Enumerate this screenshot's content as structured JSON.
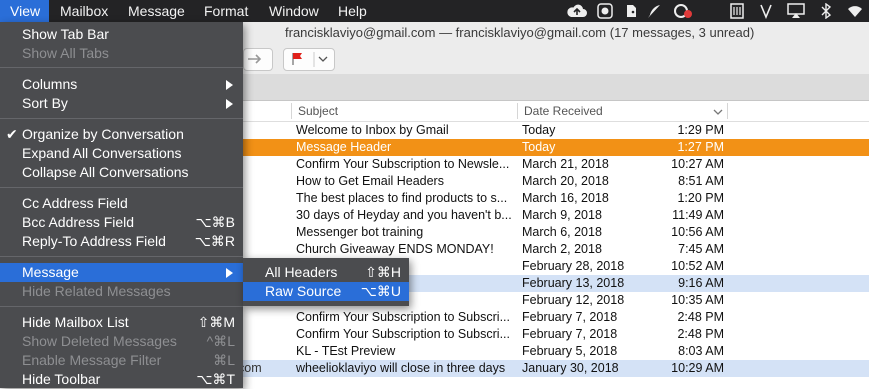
{
  "menubar": {
    "items": [
      "View",
      "Mailbox",
      "Message",
      "Format",
      "Window",
      "Help"
    ],
    "tray_icons": [
      "cloud-upload-icon",
      "record-icon",
      "evernote-icon",
      "feather-icon",
      "sync-icon",
      "notes-icon",
      "vectorworks-icon",
      "airplay-icon",
      "bluetooth-icon",
      "wifi-icon"
    ]
  },
  "window": {
    "title": "franciskla​viyo@gmail.com — franciskla​viyo@gmail.com (17 messages, 3 unread)"
  },
  "list": {
    "columns": {
      "subject": "Subject",
      "date": "Date Received"
    },
    "rows": [
      {
        "from": "",
        "subject": "Welcome to Inbox by Gmail",
        "date": "Today",
        "time": "1:29 PM"
      },
      {
        "from": "",
        "subject": "Message Header",
        "date": "Today",
        "time": "1:27 PM"
      },
      {
        "from": "",
        "subject": "Confirm Your Subscription to Newsle...",
        "date": "March 21, 2018",
        "time": "10:27 AM"
      },
      {
        "from": "",
        "subject": "How to Get Email Headers",
        "date": "March 20, 2018",
        "time": "8:51 AM"
      },
      {
        "from": "",
        "subject": "The best places to find products to s...",
        "date": "March 16, 2018",
        "time": "1:20 PM"
      },
      {
        "from": "",
        "subject": "30 days of Heyday and you haven't b...",
        "date": "March 9, 2018",
        "time": "11:49 AM"
      },
      {
        "from": "",
        "subject": "Messenger bot training",
        "date": "March 6, 2018",
        "time": "10:56 AM"
      },
      {
        "from": "",
        "subject": "Church Giveaway ENDS MONDAY!",
        "date": "March 2, 2018",
        "time": "7:45 AM"
      },
      {
        "from": "",
        "subject": "Work Check",
        "date": "February 28, 2018",
        "time": "10:52 AM"
      },
      {
        "from": "",
        "subject": "c to your life?",
        "date": "February 13, 2018",
        "time": "9:16 AM"
      },
      {
        "from": "",
        "subject": "",
        "date": "February 12, 2018",
        "time": "10:35 AM"
      },
      {
        "from": "",
        "subject": "Confirm Your Subscription to Subscri...",
        "date": "February 7, 2018",
        "time": "2:48 PM"
      },
      {
        "from": "",
        "subject": "Confirm Your Subscription to Subscri...",
        "date": "February 7, 2018",
        "time": "2:48 PM"
      },
      {
        "from": "",
        "subject": "KL - TEst Preview",
        "date": "February 5, 2018",
        "time": "8:03 AM"
      },
      {
        "from": "com",
        "subject": "wheelioklaviyo will close in three days",
        "date": "January 30, 2018",
        "time": "10:29 AM"
      }
    ]
  },
  "view_menu": {
    "show_tab_bar": "Show Tab Bar",
    "show_all_tabs": "Show All Tabs",
    "columns": "Columns",
    "sort_by": "Sort By",
    "check_mark": "✔",
    "organize": "Organize by Conversation",
    "expand_all": "Expand All Conversations",
    "collapse_all": "Collapse All Conversations",
    "cc_field": "Cc Address Field",
    "bcc_field": "Bcc Address Field",
    "bcc_shortcut": "⌥⌘B",
    "reply_to_field": "Reply-To Address Field",
    "reply_to_shortcut": "⌥⌘R",
    "message": "Message",
    "hide_related": "Hide Related Messages",
    "hide_mailbox_list": "Hide Mailbox List",
    "hide_mailbox_shortcut": "⇧⌘M",
    "show_deleted": "Show Deleted Messages",
    "show_deleted_shortcut": "^⌘L",
    "enable_filter": "Enable Message Filter",
    "enable_filter_shortcut": "⌘L",
    "hide_toolbar": "Hide Toolbar",
    "hide_toolbar_shortcut": "⌥⌘T"
  },
  "message_submenu": {
    "all_headers": "All Headers",
    "all_headers_shortcut": "⇧⌘H",
    "raw_source": "Raw Source",
    "raw_source_shortcut": "⌥⌘U"
  },
  "colors": {
    "menu_bg": "#4b4c4f",
    "highlight": "#2a6ed8",
    "selected_row": "#f29116",
    "unread_row": "#d4e2f6"
  }
}
